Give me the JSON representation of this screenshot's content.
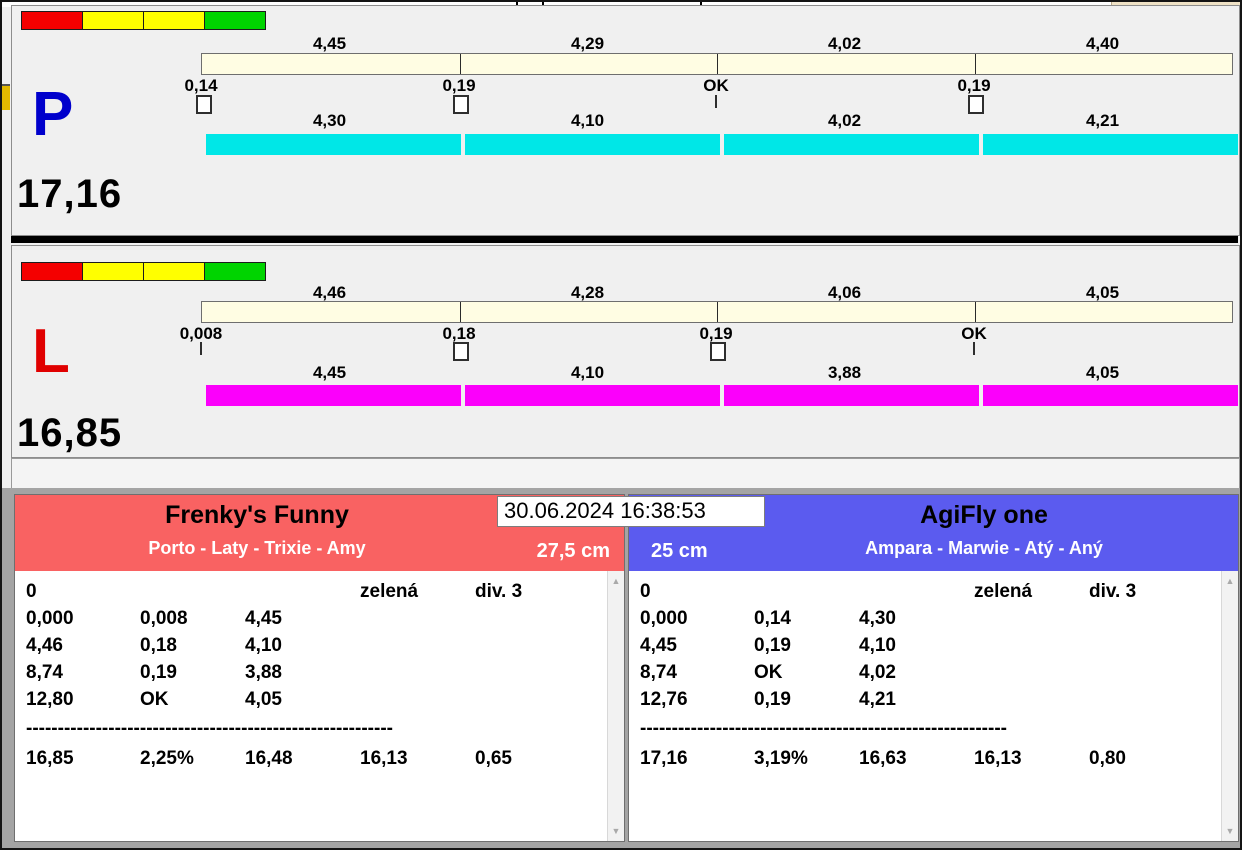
{
  "window": {
    "timestamp": "30.06.2024 16:38:53"
  },
  "icons": {
    "scroll_up": "▲",
    "scroll_down": "▼"
  },
  "colors": {
    "panel_p_run_bar": "#00e7e7",
    "panel_l_run_bar": "#fb00fb",
    "reference_bar": "#fffde3",
    "left_team_header": "#f96262",
    "right_team_header": "#5b5bef",
    "traffic_lights": [
      "#f40000",
      "#ffff00",
      "#ffff00",
      "#00d400"
    ],
    "p_letter": "#0000cc",
    "l_letter": "#e00000"
  },
  "panel_p": {
    "label": "P",
    "total": "17,16",
    "ref_values": [
      "4,45",
      "4,29",
      "4,02",
      "4,40"
    ],
    "split_values": [
      "0,14",
      "0,19",
      "OK",
      "0,19"
    ],
    "split_markers": [
      "box",
      "box",
      "tick",
      "box"
    ],
    "run_values": [
      "4,30",
      "4,10",
      "4,02",
      "4,21"
    ]
  },
  "panel_l": {
    "label": "L",
    "total": "16,85",
    "ref_values": [
      "4,46",
      "4,28",
      "4,06",
      "4,05"
    ],
    "split_values": [
      "0,008",
      "0,18",
      "0,19",
      "OK"
    ],
    "split_markers": [
      "tick",
      "box",
      "box",
      "tick"
    ],
    "run_values": [
      "4,45",
      "4,10",
      "3,88",
      "4,05"
    ]
  },
  "teams": {
    "left": {
      "name": "Frenky's Funny",
      "members": "Porto - Laty - Trixie - Amy",
      "height": "27,5 cm",
      "status": {
        "faults": "0",
        "color": "zelená",
        "division": "div. 3"
      },
      "splits": [
        [
          "0,000",
          "0,008",
          "4,45"
        ],
        [
          "4,46",
          "0,18",
          "4,10"
        ],
        [
          "8,74",
          "0,19",
          "3,88"
        ],
        [
          "12,80",
          "OK",
          "4,05"
        ]
      ],
      "separator": "----------------------------------------------------------",
      "summary": [
        "16,85",
        "2,25%",
        "16,48",
        "16,13",
        "0,65"
      ]
    },
    "right": {
      "name": "AgiFly one",
      "members": "Ampara - Marwie - Atý - Aný",
      "height": "25 cm",
      "status": {
        "faults": "0",
        "color": "zelená",
        "division": "div. 3"
      },
      "splits": [
        [
          "0,000",
          "0,14",
          "4,30"
        ],
        [
          "4,45",
          "0,19",
          "4,10"
        ],
        [
          "8,74",
          "OK",
          "4,02"
        ],
        [
          "12,76",
          "0,19",
          "4,21"
        ]
      ],
      "separator": "----------------------------------------------------------",
      "summary": [
        "17,16",
        "3,19%",
        "16,63",
        "16,13",
        "0,80"
      ]
    }
  }
}
